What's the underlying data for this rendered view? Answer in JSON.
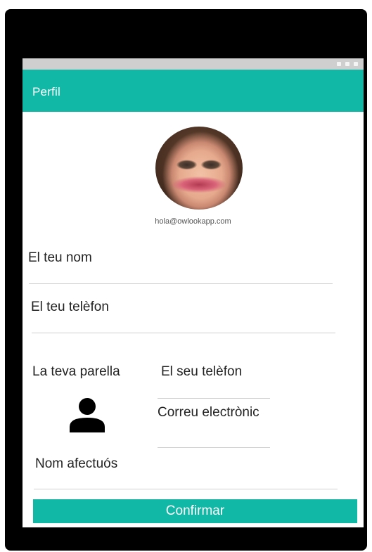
{
  "app_bar": {
    "title": "Perfil",
    "color": "#12b8a6"
  },
  "profile": {
    "email": "hola@owlookapp.com"
  },
  "form": {
    "name_placeholder": "El teu nom",
    "phone_placeholder": "El teu telèfon",
    "partner_label": "La teva parella",
    "partner_phone_placeholder": "El seu telèfon",
    "partner_email_placeholder": "Correu electrònic",
    "nickname_placeholder": "Nom afectuós"
  },
  "actions": {
    "confirm_label": "Confirmar"
  },
  "icons": {
    "partner_avatar": "person-icon"
  }
}
